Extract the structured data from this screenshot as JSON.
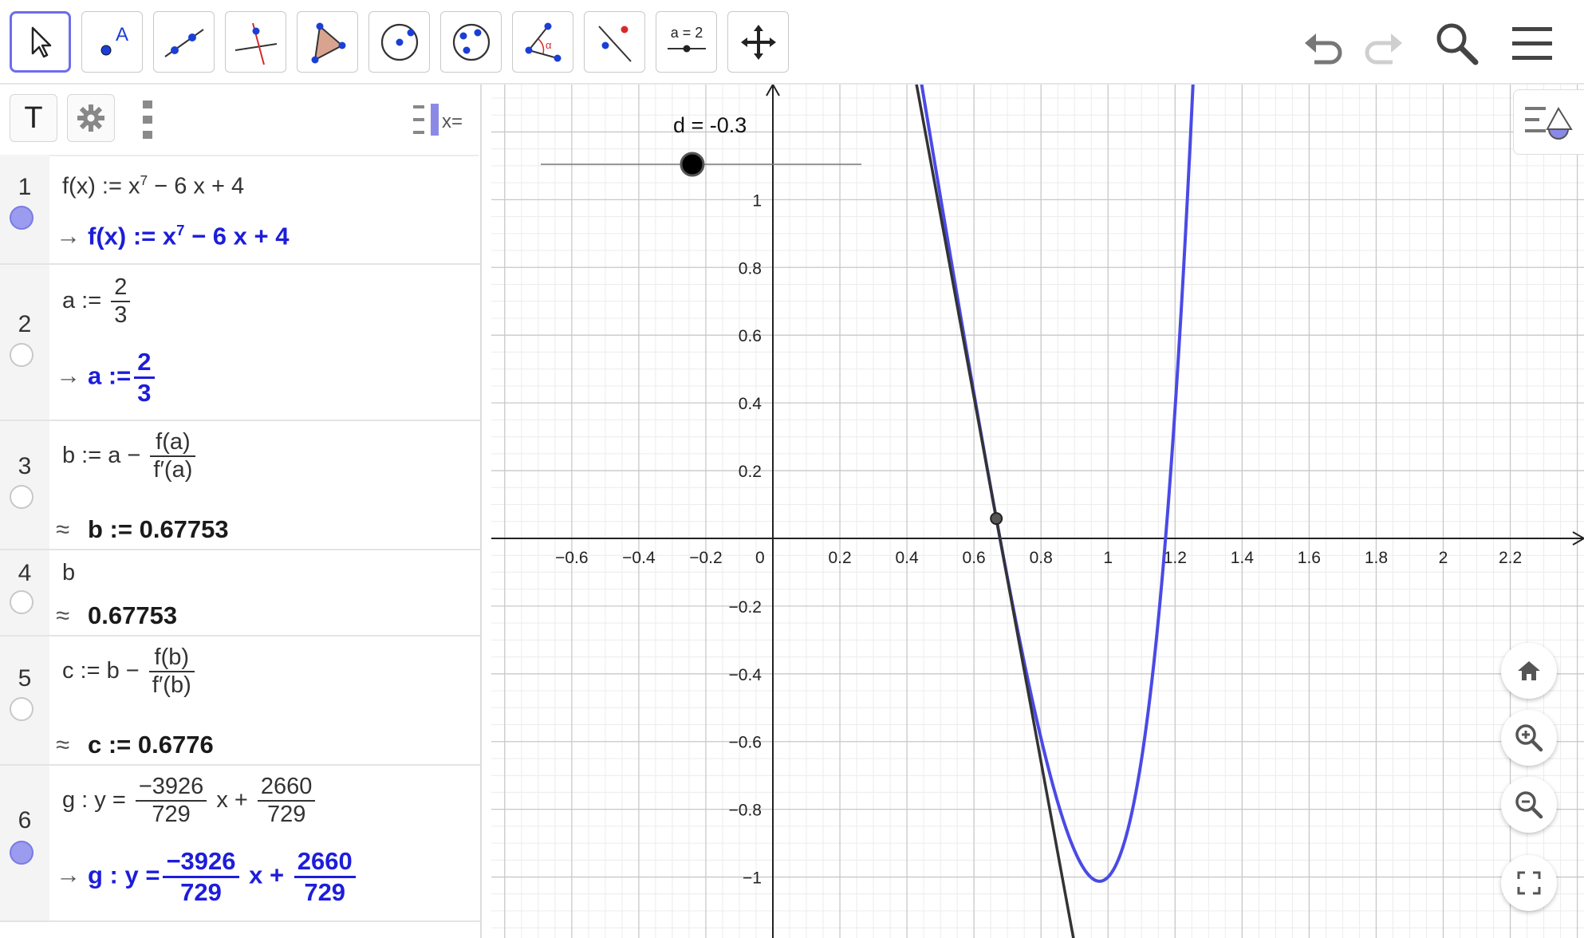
{
  "toolbar": {
    "tools": [
      {
        "name": "move-tool",
        "selected": true
      },
      {
        "name": "point-tool",
        "label": "A"
      },
      {
        "name": "line-tool"
      },
      {
        "name": "perpendicular-line-tool"
      },
      {
        "name": "polygon-tool"
      },
      {
        "name": "circle-center-point-tool"
      },
      {
        "name": "circle-three-points-tool"
      },
      {
        "name": "angle-tool",
        "label": "α"
      },
      {
        "name": "reflect-tool"
      },
      {
        "name": "slider-tool",
        "label": "a = 2"
      },
      {
        "name": "move-graphics-view-tool"
      }
    ],
    "right_icons": [
      "undo-icon",
      "redo-icon",
      "search-icon",
      "menu-icon"
    ]
  },
  "algebra": {
    "header": {
      "text_button": "T",
      "settings_icon": "gear-icon",
      "more_icon": "more-vert-icon",
      "algebra_input_icon": "x="
    },
    "rows": [
      {
        "num": "1",
        "visible": true,
        "input_lhs": "f(x) := x",
        "input_exp": "7",
        "input_rhs": " − 6 x + 4",
        "out_symbol": "→",
        "out_lhs": "f(x)  :=  x",
        "out_exp": "7",
        "out_rhs": " − 6 x + 4",
        "out_color": "blue"
      },
      {
        "num": "2",
        "visible": false,
        "input_lhs": "a := ",
        "input_num": "2",
        "input_den": "3",
        "out_symbol": "→",
        "out_lhs": "a  :=",
        "out_num": "2",
        "out_den": "3",
        "out_color": "blue"
      },
      {
        "num": "3",
        "visible": false,
        "input_lhs": "b := a − ",
        "input_num": "f(a)",
        "input_den": "f′(a)",
        "out_symbol": "≈",
        "out_text": "b  :=  0.67753",
        "out_color": "black"
      },
      {
        "num": "4",
        "visible": false,
        "input_text": "b",
        "out_symbol": "≈",
        "out_text": "0.67753",
        "out_color": "black"
      },
      {
        "num": "5",
        "visible": false,
        "input_lhs": "c := b − ",
        "input_num": "f(b)",
        "input_den": "f′(b)",
        "out_symbol": "≈",
        "out_text": "c  :=  0.6776",
        "out_color": "black"
      },
      {
        "num": "6",
        "visible": true,
        "input_lhs": "g : y  = ",
        "input_num1": "−3926",
        "input_den1": "729",
        "input_mid": " x + ",
        "input_num2": "2660",
        "input_den2": "729",
        "out_symbol": "→",
        "out_lhs": "g :  y =",
        "out_num1": "−3926",
        "out_den1": "729",
        "out_mid": " x + ",
        "out_num2": "2660",
        "out_den2": "729",
        "out_color": "blue"
      }
    ]
  },
  "graphics": {
    "slider": {
      "label": "d = -0.3",
      "value": -0.3
    },
    "buttons": [
      "home-icon",
      "zoom-in-icon",
      "zoom-out-icon",
      "fullscreen-icon"
    ],
    "style_bar_icon": "graphics-style-icon"
  },
  "chart_data": {
    "type": "line",
    "title": "",
    "xlabel": "",
    "ylabel": "",
    "xlim": [
      -0.84,
      2.42
    ],
    "ylim": [
      -1.18,
      1.34
    ],
    "x_ticks": [
      "−0.6",
      "−0.4",
      "−0.2",
      "0",
      "0.2",
      "0.4",
      "0.6",
      "0.8",
      "1",
      "1.2",
      "1.4",
      "1.6",
      "1.8",
      "2",
      "2.2"
    ],
    "y_ticks": [
      "1",
      "0.8",
      "0.6",
      "0.4",
      "0.2",
      "−0.2",
      "−0.4",
      "−0.6",
      "−0.8",
      "−1"
    ],
    "series": [
      {
        "name": "f",
        "expression": "x^7 - 6x + 4",
        "color": "#4a4ae6"
      },
      {
        "name": "g",
        "expression": "-3926/729 x + 2660/729",
        "color": "#333333"
      }
    ],
    "points": [
      {
        "x": 0.6667,
        "y": 0.0585
      }
    ],
    "grid": true
  },
  "colors": {
    "accent": "#6d6deb",
    "curve_f": "#4a4ae6",
    "line_g": "#333333",
    "output_blue": "#1d1ddb"
  }
}
